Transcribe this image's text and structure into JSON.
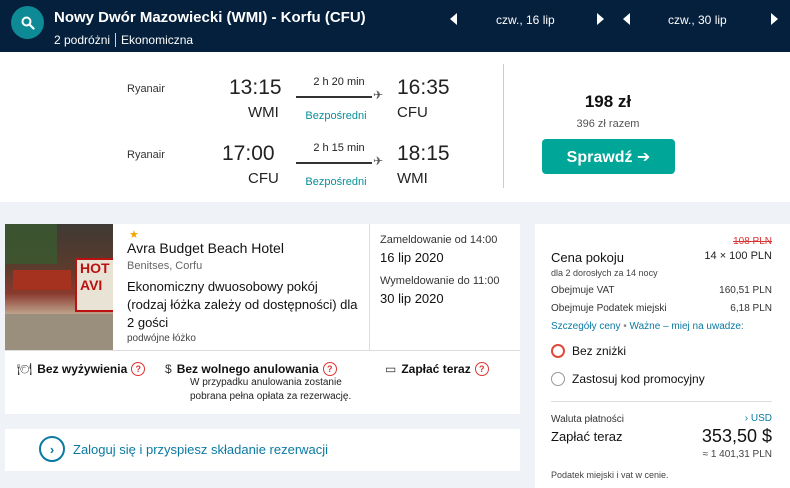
{
  "header": {
    "route": "Nowy Dwór Mazowiecki (WMI) - Korfu (CFU)",
    "travellers": "2 podróżni",
    "cabin": "Ekonomiczna",
    "depart_date": "czw., 16 lip",
    "return_date": "czw., 30 lip"
  },
  "flights": {
    "outbound": {
      "airline": "Ryanair",
      "dep_time": "13:15",
      "dep_code": "WMI",
      "duration": "2 h 20 min",
      "stops": "Bezpośredni",
      "arr_time": "16:35",
      "arr_code": "CFU"
    },
    "inbound": {
      "airline": "Ryanair",
      "dep_time": "17:00",
      "dep_code": "CFU",
      "duration": "2 h 15 min",
      "stops": "Bezpośredni",
      "arr_time": "18:15",
      "arr_code": "WMI"
    },
    "price": "198 zł",
    "price_total": "396 zł razem",
    "cta_label": "Sprawdź ➔"
  },
  "hotel": {
    "stars": "★",
    "name": "Avra Budget Beach Hotel",
    "location": "Benitses, Corfu",
    "room": "Ekonomiczny dwuosobowy pokój (rodzaj łóżka zależy od dostępności) dla 2 gości",
    "bed": "podwójne łóżko",
    "checkin_label": "Zameldowanie od 14:00",
    "checkin_date": "16 lip 2020",
    "checkout_label": "Wymeldowanie do 11:00",
    "checkout_date": "30 lip 2020",
    "features": {
      "meals": "Bez wyżywienia",
      "cancellation": "Bez wolnego anulowania",
      "pay": "Zapłać teraz",
      "cancellation_note": "W przypadku anulowania zostanie pobrana pełna opłata za rezerwację."
    },
    "image_sign": [
      "HOT",
      "AVI"
    ]
  },
  "login": {
    "text": "Zaloguj się i przyspiesz składanie rezerwacji"
  },
  "pricing": {
    "old_price": "108 PLN",
    "room_price_label": "Cena pokoju",
    "nightly": "14 × 100 PLN",
    "guests_nights": "dla 2 dorosłych  za 14 nocy",
    "vat_label": "Obejmuje VAT",
    "vat_value": "160,51 PLN",
    "city_tax_label": "Obejmuje Podatek miejski",
    "city_tax_value": "6,18 PLN",
    "details_link": "Szczegóły ceny",
    "important_link": "Ważne – miej na uwadze:",
    "no_discount": "Bez zniżki",
    "promo_code": "Zastosuj kod promocyjny",
    "currency_label": "Waluta płatności",
    "currency_value": "› USD",
    "pay_now_label": "Zapłać teraz",
    "pay_now_amount": "353,50 $",
    "pay_now_pln": "≈ 1 401,31 PLN",
    "tax_note": "Podatek miejski i vat w cenie."
  },
  "colors": {
    "header_bg": "#05203c",
    "accent_teal": "#00a698",
    "link_blue": "#0a7aa3",
    "warning_red": "#d33"
  }
}
